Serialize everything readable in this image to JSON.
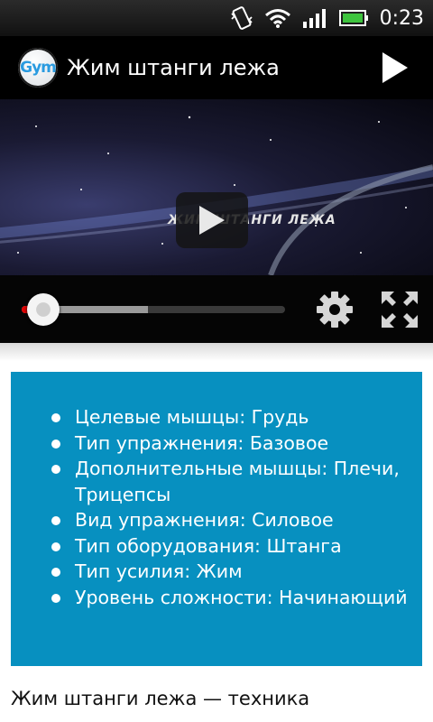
{
  "status_bar": {
    "time": "0:23"
  },
  "app_bar": {
    "logo_text": "Gym",
    "title": "Жим штанги лежа",
    "play_icon": "play-icon"
  },
  "video": {
    "overlay_title": "ЖИМ ШТАНГИ ЛЕЖА",
    "progress": {
      "played": 0.08,
      "buffered": 0.48
    }
  },
  "details": {
    "items": [
      "Целевые мышцы: Грудь",
      "Тип упражнения: Базовое",
      "Дополнительные мышцы: Плечи, Трицепсы",
      "Вид упражнения: Силовое",
      "Тип оборудования: Штанга",
      "Тип усилия: Жим",
      "Уровень сложности: Начинающий"
    ]
  },
  "section_heading": "Жим штанги лежа — техника",
  "colors": {
    "info_background": "#0790c0",
    "progress_played": "#e10000"
  }
}
